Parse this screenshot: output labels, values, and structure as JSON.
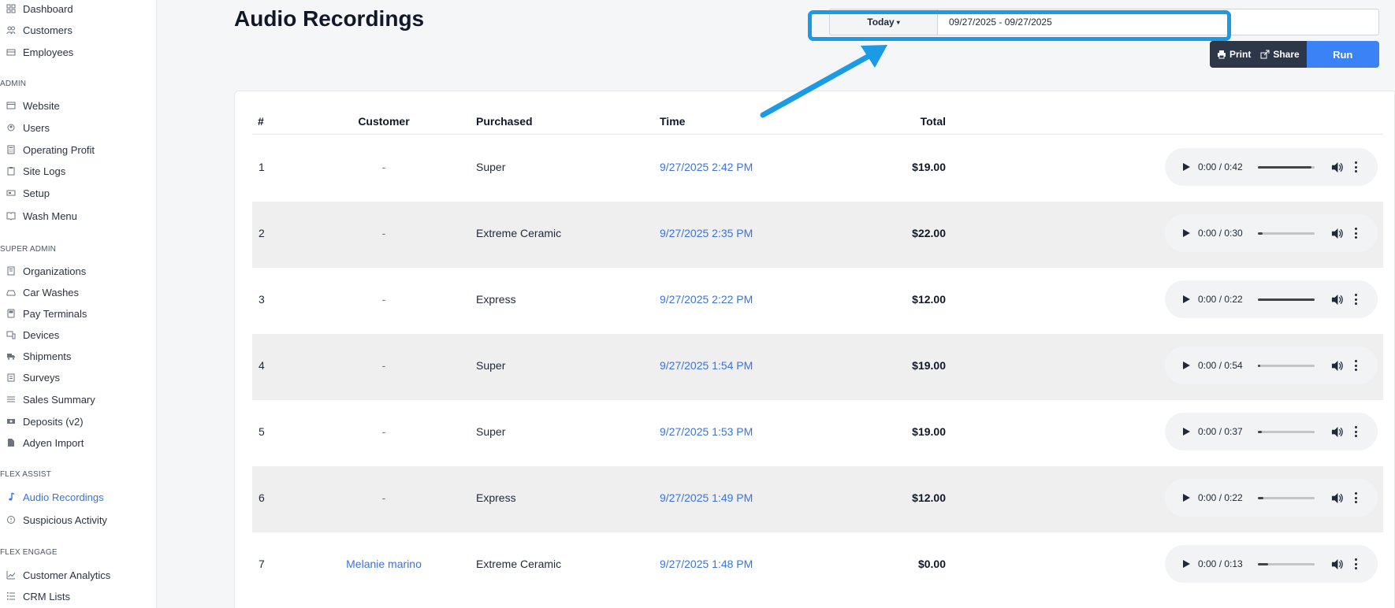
{
  "sidebar": {
    "items": [
      {
        "label": "Dashboard",
        "icon": "dashboard-icon"
      },
      {
        "label": "Customers",
        "icon": "customers-icon"
      },
      {
        "label": "Employees",
        "icon": "employees-icon"
      },
      {
        "label": "Website",
        "icon": "website-icon"
      },
      {
        "label": "Users",
        "icon": "users-icon"
      },
      {
        "label": "Operating Profit",
        "icon": "calculator-icon"
      },
      {
        "label": "Site Logs",
        "icon": "clipboard-icon"
      },
      {
        "label": "Setup",
        "icon": "setup-icon"
      },
      {
        "label": "Wash Menu",
        "icon": "menu-book-icon"
      },
      {
        "label": "Organizations",
        "icon": "building-icon"
      },
      {
        "label": "Car Washes",
        "icon": "car-wash-icon"
      },
      {
        "label": "Pay Terminals",
        "icon": "terminal-icon"
      },
      {
        "label": "Devices",
        "icon": "devices-icon"
      },
      {
        "label": "Shipments",
        "icon": "truck-icon"
      },
      {
        "label": "Surveys",
        "icon": "survey-icon"
      },
      {
        "label": "Sales Summary",
        "icon": "list-icon"
      },
      {
        "label": "Deposits (v2)",
        "icon": "money-icon"
      },
      {
        "label": "Adyen Import",
        "icon": "file-icon"
      },
      {
        "label": "Audio Recordings",
        "icon": "music-note-icon",
        "active": true
      },
      {
        "label": "Suspicious Activity",
        "icon": "alert-icon"
      },
      {
        "label": "Customer Analytics",
        "icon": "chart-line-icon"
      },
      {
        "label": "CRM Lists",
        "icon": "list-check-icon"
      }
    ],
    "sections": [
      "ADMIN",
      "SUPER ADMIN",
      "FLEX ASSIST",
      "FLEX ENGAGE"
    ]
  },
  "header": {
    "title": "Audio Recordings",
    "preset": "Today",
    "date_range": "09/27/2025 - 09/27/2025",
    "print_label": "Print",
    "share_label": "Share",
    "run_label": "Run"
  },
  "table": {
    "columns": [
      "#",
      "Customer",
      "Purchased",
      "Time",
      "Total"
    ],
    "rows": [
      {
        "num": "1",
        "customer": "-",
        "purchased": "Super",
        "time": "9/27/2025 2:42 PM",
        "total": "$19.00",
        "audio_time": "0:00 / 0:42",
        "progress": 0.95
      },
      {
        "num": "2",
        "customer": "-",
        "purchased": "Extreme Ceramic",
        "time": "9/27/2025 2:35 PM",
        "total": "$22.00",
        "audio_time": "0:00 / 0:30",
        "progress": 0.08
      },
      {
        "num": "3",
        "customer": "-",
        "purchased": "Express",
        "time": "9/27/2025 2:22 PM",
        "total": "$12.00",
        "audio_time": "0:00 / 0:22",
        "progress": 1.0
      },
      {
        "num": "4",
        "customer": "-",
        "purchased": "Super",
        "time": "9/27/2025 1:54 PM",
        "total": "$19.00",
        "audio_time": "0:00 / 0:54",
        "progress": 0.04
      },
      {
        "num": "5",
        "customer": "-",
        "purchased": "Super",
        "time": "9/27/2025 1:53 PM",
        "total": "$19.00",
        "audio_time": "0:00 / 0:37",
        "progress": 0.07
      },
      {
        "num": "6",
        "customer": "-",
        "purchased": "Express",
        "time": "9/27/2025 1:49 PM",
        "total": "$12.00",
        "audio_time": "0:00 / 0:22",
        "progress": 0.1
      },
      {
        "num": "7",
        "customer": "Melanie marino",
        "customer_link": true,
        "purchased": "Extreme Ceramic",
        "time": "9/27/2025 1:48 PM",
        "total": "$0.00",
        "audio_time": "0:00 / 0:13",
        "progress": 0.18
      }
    ]
  },
  "colors": {
    "accent": "#3b73d9",
    "run_button": "#3b82f6",
    "dark_button": "#2d3748",
    "highlight": "#1b9be6",
    "row_alt": "#efeff0"
  }
}
